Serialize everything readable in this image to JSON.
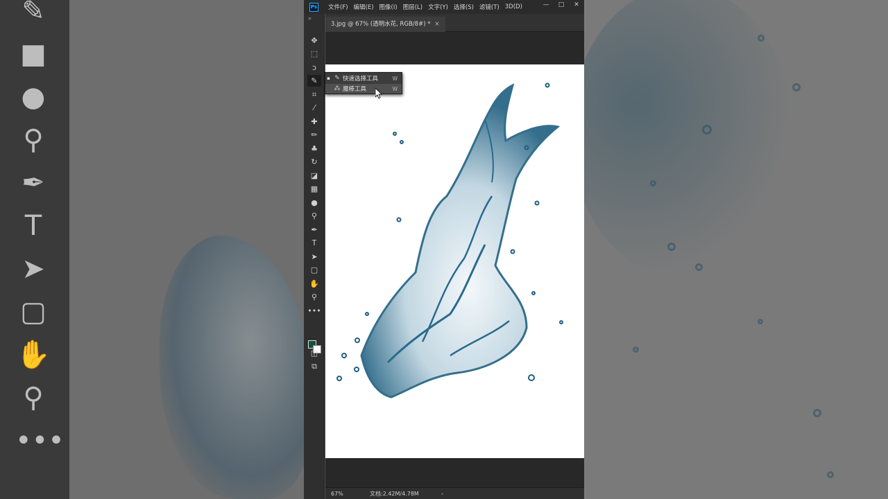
{
  "menubar": {
    "logo": "Ps",
    "items": [
      "文件(F)",
      "编辑(E)",
      "图像(I)",
      "图层(L)",
      "文字(Y)",
      "选择(S)",
      "滤镜(T)",
      "3D(D)"
    ]
  },
  "window_controls": {
    "minimize": "—",
    "maximize": "□",
    "close": "✕"
  },
  "document": {
    "tab_title": "3.jpg @ 67% (透明水花, RGB/8#) *",
    "tab_close": "×"
  },
  "toolbar": {
    "collapse": "»",
    "tools": [
      {
        "name": "move-tool-icon",
        "glyph": "✥"
      },
      {
        "name": "marquee-tool-icon",
        "glyph": "⬚"
      },
      {
        "name": "lasso-tool-icon",
        "glyph": "ↄ"
      },
      {
        "name": "quick-selection-tool-icon",
        "glyph": "✎"
      },
      {
        "name": "crop-tool-icon",
        "glyph": "⌗"
      },
      {
        "name": "eyedropper-tool-icon",
        "glyph": "⁄"
      },
      {
        "name": "healing-brush-tool-icon",
        "glyph": "✚"
      },
      {
        "name": "brush-tool-icon",
        "glyph": "✏"
      },
      {
        "name": "clone-stamp-tool-icon",
        "glyph": "♣"
      },
      {
        "name": "history-brush-tool-icon",
        "glyph": "↻"
      },
      {
        "name": "eraser-tool-icon",
        "glyph": "◪"
      },
      {
        "name": "gradient-tool-icon",
        "glyph": "▦"
      },
      {
        "name": "blur-tool-icon",
        "glyph": "●"
      },
      {
        "name": "dodge-tool-icon",
        "glyph": "⚲"
      },
      {
        "name": "pen-tool-icon",
        "glyph": "✒"
      },
      {
        "name": "type-tool-icon",
        "glyph": "T"
      },
      {
        "name": "path-selection-tool-icon",
        "glyph": "➤"
      },
      {
        "name": "shape-tool-icon",
        "glyph": "▢"
      },
      {
        "name": "hand-tool-icon",
        "glyph": "✋"
      },
      {
        "name": "zoom-tool-icon",
        "glyph": "⚲"
      },
      {
        "name": "more-tools-icon",
        "glyph": "•••"
      }
    ],
    "colors": {
      "foreground": "#13503b",
      "background": "#ffffff"
    }
  },
  "flyout": {
    "items": [
      {
        "bullet": "▪",
        "label": "快速选择工具",
        "key": "W"
      },
      {
        "bullet": "",
        "label": "魔棒工具",
        "key": "W"
      }
    ]
  },
  "statusbar": {
    "zoom": "67%",
    "doc_size": "文档:2.42M/4.78M",
    "arrow": "›"
  },
  "side_toolbar": {
    "glyphs": [
      "✎",
      "■",
      "●",
      "⚲",
      "✒",
      "T",
      "➤",
      "▢",
      "✋",
      "⚲",
      "•••"
    ]
  }
}
